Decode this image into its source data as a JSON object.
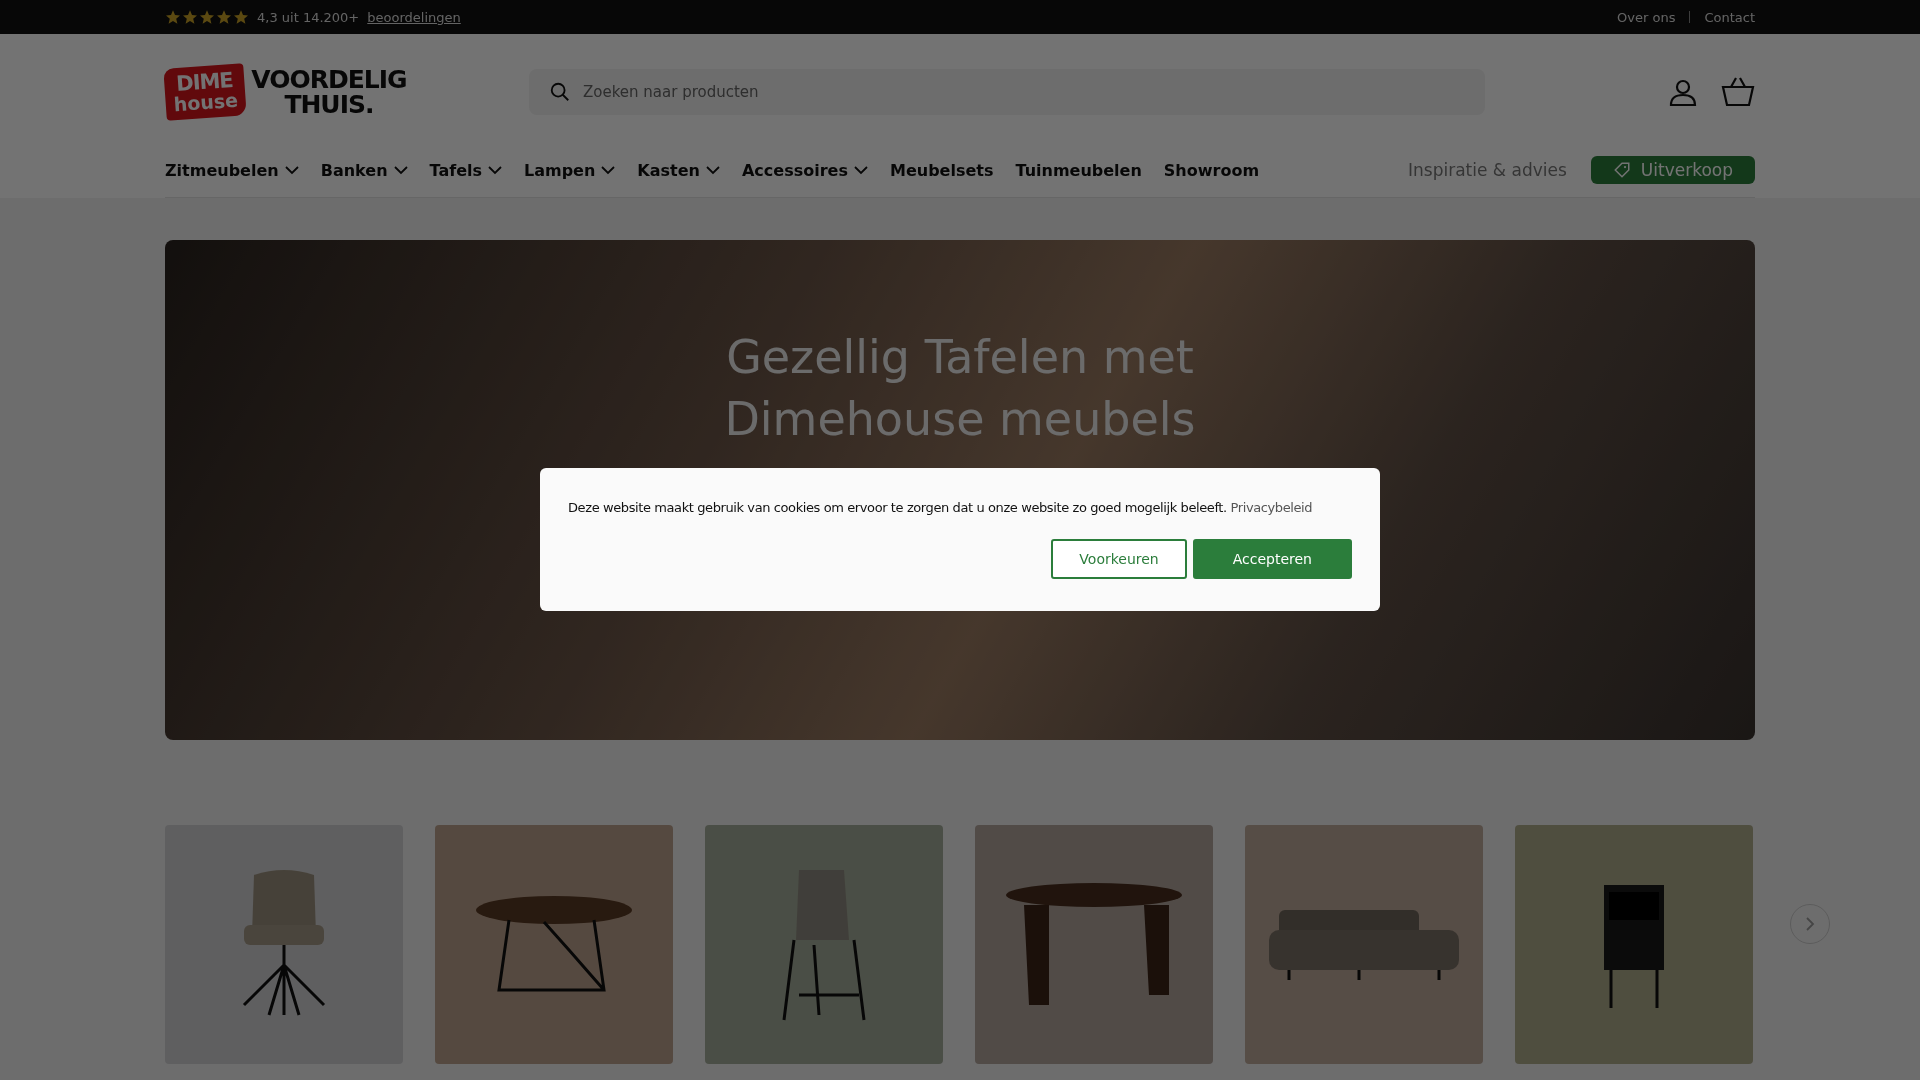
{
  "top_bar": {
    "stars": 5,
    "rating": "4,3 uit 14.200+",
    "reviews_link": "beoordelingen",
    "links": [
      "Over ons",
      "Contact"
    ]
  },
  "header": {
    "logo": {
      "badge_top": "DIME",
      "badge_bottom": "house",
      "wordmark_line1": "VOORDELIG",
      "wordmark_line2": "THUIS."
    },
    "search": {
      "placeholder": "Zoeken naar producten"
    }
  },
  "nav": {
    "items": [
      {
        "label": "Zitmeubelen",
        "dropdown": true
      },
      {
        "label": "Banken",
        "dropdown": true
      },
      {
        "label": "Tafels",
        "dropdown": true
      },
      {
        "label": "Lampen",
        "dropdown": true
      },
      {
        "label": "Kasten",
        "dropdown": true
      },
      {
        "label": "Accessoires",
        "dropdown": true
      },
      {
        "label": "Meubelsets",
        "dropdown": false
      },
      {
        "label": "Tuinmeubelen",
        "dropdown": false
      },
      {
        "label": "Showroom",
        "dropdown": false
      }
    ],
    "secondary": [
      {
        "label": "Inspiratie & advies",
        "kind": "link"
      },
      {
        "label": "Uitverkoop",
        "kind": "tag"
      }
    ]
  },
  "hero": {
    "title": "Gezellig Tafelen met Dimehouse meubels"
  },
  "products": [
    {
      "kind": "chair"
    },
    {
      "kind": "coffee-table"
    },
    {
      "kind": "bar-stool"
    },
    {
      "kind": "dining-table"
    },
    {
      "kind": "sofa"
    },
    {
      "kind": "nightstand"
    }
  ],
  "cookie_banner": {
    "message": "Deze website maakt gebruik van cookies om ervoor te zorgen dat u onze website zo goed mogelijk beleeft.",
    "link": "Privacybeleid",
    "buttons": [
      {
        "label": "Voorkeuren",
        "kind": "outline"
      },
      {
        "label": "Accepteren",
        "kind": "primary"
      }
    ]
  }
}
